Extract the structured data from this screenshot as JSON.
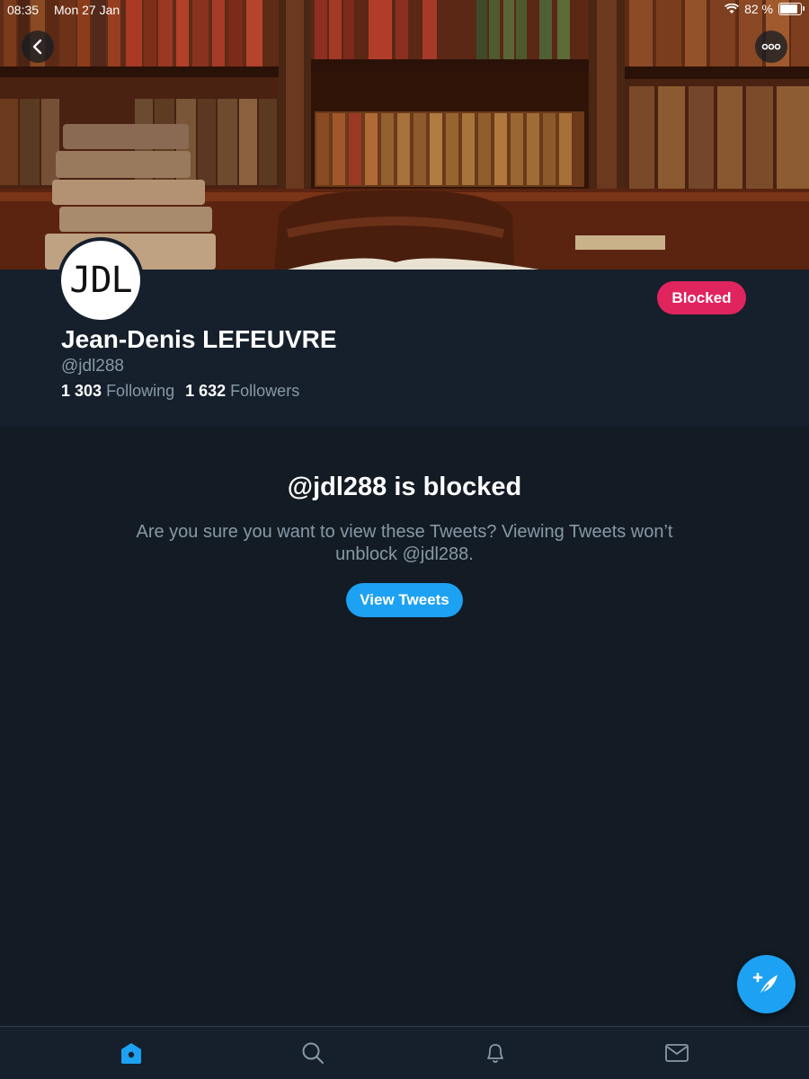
{
  "status_bar": {
    "time": "08:35",
    "date": "Mon 27 Jan",
    "battery_percent": "82 %",
    "battery_level": 0.82,
    "icons": [
      "wifi-icon",
      "battery-icon"
    ]
  },
  "navigation": {
    "back_icon": "chevron-left-icon",
    "more_icon": "more-horizontal-icon"
  },
  "profile": {
    "avatar_text": "JDL",
    "name": "Jean-Denis LEFEUVRE",
    "handle": "@jdl288",
    "following_count": "1 303",
    "following_label": "Following",
    "followers_count": "1 632",
    "followers_label": "Followers",
    "blocked_button": "Blocked"
  },
  "blocked_notice": {
    "title": "@jdl288 is blocked",
    "message": "Are you sure you want to view these Tweets? Viewing Tweets won’t unblock @jdl288.",
    "button": "View Tweets"
  },
  "compose": {
    "icon": "compose-feather-icon"
  },
  "tab_bar": {
    "tabs": [
      {
        "icon": "home-icon",
        "active": true
      },
      {
        "icon": "search-icon",
        "active": false
      },
      {
        "icon": "bell-icon",
        "active": false
      },
      {
        "icon": "mail-icon",
        "active": false
      }
    ]
  },
  "colors": {
    "background": "#131b24",
    "header_bg": "#16202c",
    "accent_blue": "#1da1f2",
    "blocked_red": "#e0245e",
    "muted_text": "#8899a6"
  }
}
